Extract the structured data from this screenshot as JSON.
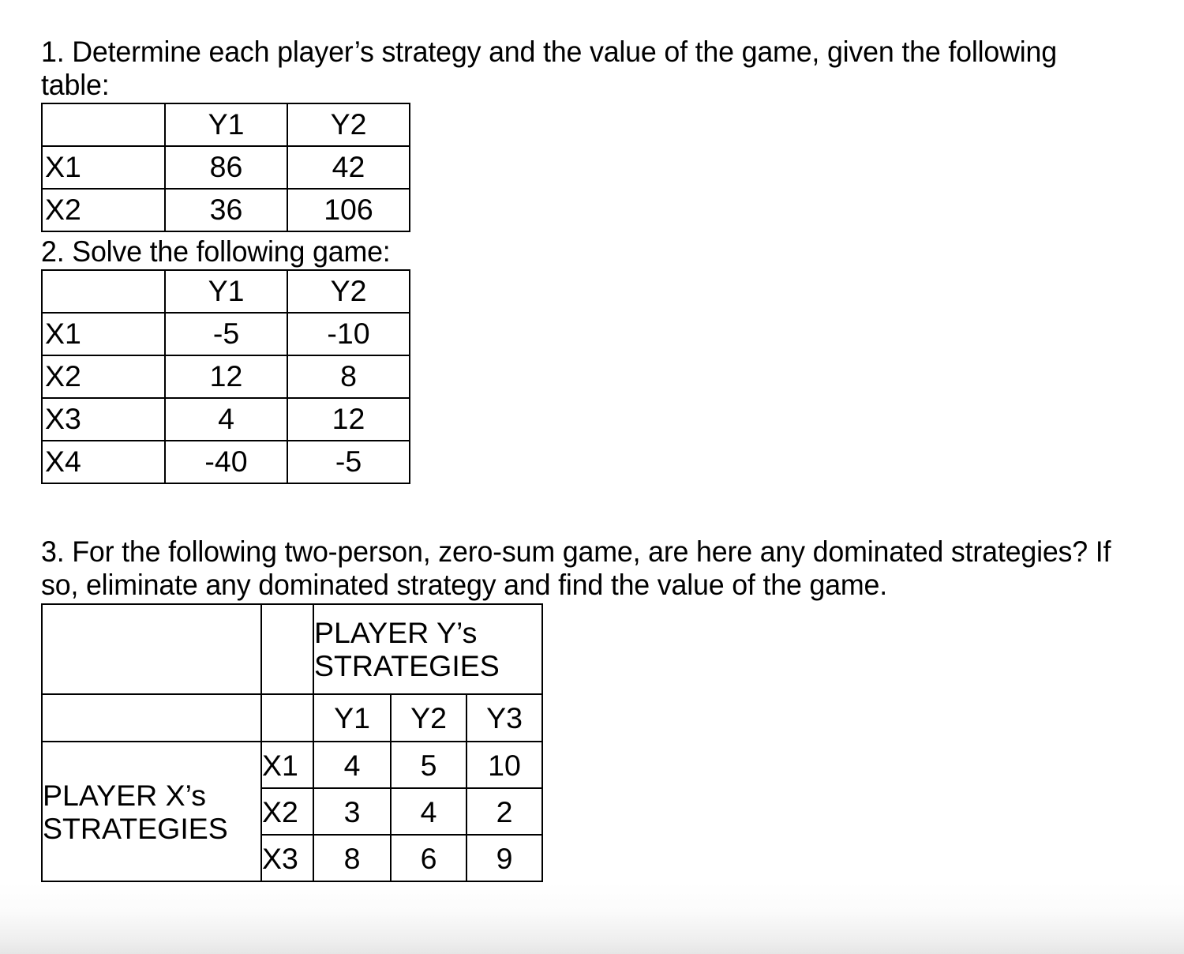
{
  "document": {
    "question1": {
      "text": "1. Determine each player’s strategy and the value of the game, given the following table:",
      "table": {
        "header": [
          "",
          "Y1",
          "Y2"
        ],
        "rows": [
          {
            "label": "X1",
            "values": [
              "86",
              "42"
            ]
          },
          {
            "label": "X2",
            "values": [
              "36",
              "106"
            ]
          }
        ]
      }
    },
    "question2": {
      "text": "2. Solve the following game:",
      "table": {
        "header": [
          "",
          "Y1",
          "Y2"
        ],
        "rows": [
          {
            "label": "X1",
            "values": [
              "-5",
              "-10"
            ]
          },
          {
            "label": "X2",
            "values": [
              "12",
              "8"
            ]
          },
          {
            "label": "X3",
            "values": [
              "4",
              "12"
            ]
          },
          {
            "label": "X4",
            "values": [
              "-40",
              "-5"
            ]
          }
        ]
      }
    },
    "question3": {
      "text": "3. For the following two-person, zero-sum game, are here any dominated strategies? If so, eliminate any dominated strategy and find the value of the game.",
      "table": {
        "column_group_label_line1": "PLAYER Y’s",
        "column_group_label_line2": "STRATEGIES",
        "row_group_label_line1": "PLAYER X’s",
        "row_group_label_line2": "STRATEGIES",
        "column_headers": [
          "Y1",
          "Y2",
          "Y3"
        ],
        "rows": [
          {
            "label": "X1",
            "values": [
              "4",
              "5",
              "10"
            ]
          },
          {
            "label": "X2",
            "values": [
              "3",
              "4",
              "2"
            ]
          },
          {
            "label": "X3",
            "values": [
              "8",
              "6",
              "9"
            ]
          }
        ]
      }
    }
  }
}
